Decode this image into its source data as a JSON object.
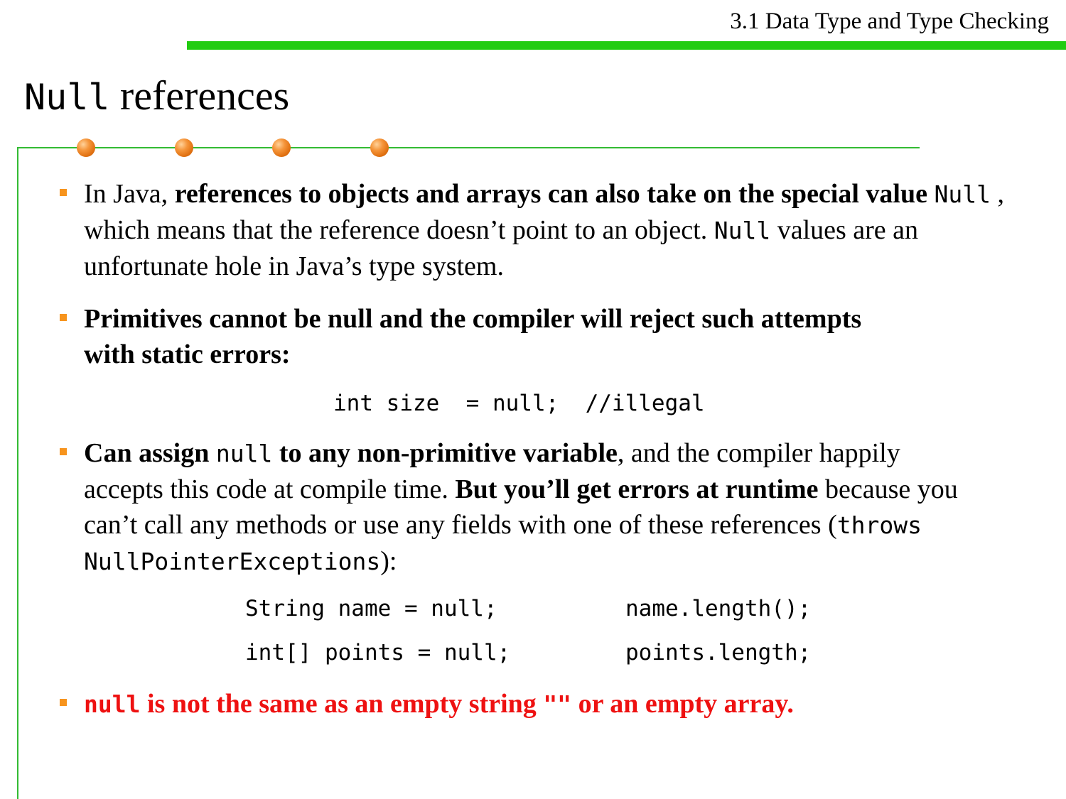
{
  "header": {
    "section": "3.1 Data Type and Type Checking"
  },
  "title": {
    "code": "Null",
    "rest": " references"
  },
  "bullets": [
    {
      "t1": "In Java, ",
      "b1": "references to objects and arrays can also take on the special value",
      "c1": "Null",
      "t2": " , which means that the reference doesn’t point to an object. ",
      "c2": "Null",
      "t3": " values are an unfortunate hole in Java’s type system."
    },
    {
      "b1": "Primitives cannot be null and the compiler will reject such attempts with static errors:"
    },
    {
      "b1": "Can assign ",
      "c1": "null",
      "b2": " to any non-primitive variable",
      "t1": ", and the compiler happily accepts this code at compile time. ",
      "b3": "But you’ll get errors at runtime",
      "t2": " because you can’t call any methods or use any fields with one of these references (",
      "c2": "throws",
      "t3": " ",
      "c3": "NullPointerExceptions",
      "t4": "):"
    },
    {
      "c1": "null",
      "b1": " is not the same as an empty string ",
      "c2": "\"\"",
      "b2": "  or an empty array."
    }
  ],
  "code": {
    "illegal": "int size  = null;  //illegal",
    "row1_left": "String name = null;",
    "row1_right": "name.length();",
    "row2_left": "int[] points = null;",
    "row2_right": "points.length;"
  },
  "colors": {
    "rule": "#22cc11",
    "frame": "#33bb33",
    "bullet": "#f7941d",
    "dot": "#e07010",
    "warning_text": "#ee1111"
  }
}
